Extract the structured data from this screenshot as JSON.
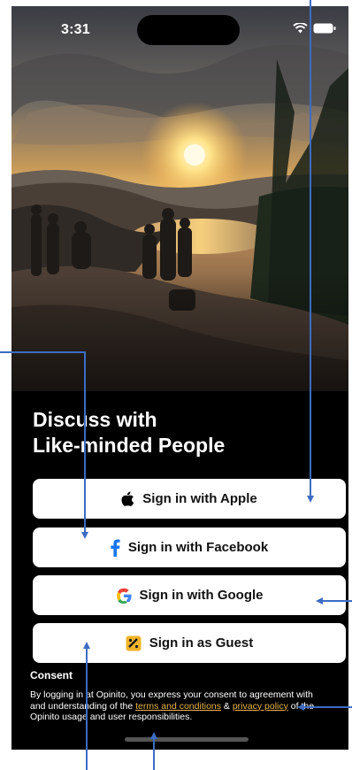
{
  "status_bar": {
    "time": "3:31",
    "icons": [
      "wifi-icon",
      "battery-icon"
    ]
  },
  "hero_image": {
    "description_icon": "sunset-landscape-photo"
  },
  "headline": {
    "line1": "Discuss with",
    "line2": "Like-minded People"
  },
  "buttons": {
    "apple": {
      "label": "Sign in with Apple",
      "icon": "apple-logo-icon"
    },
    "facebook": {
      "label": "Sign in with Facebook",
      "icon": "facebook-logo-icon"
    },
    "google": {
      "label": "Sign in with Google",
      "icon": "google-logo-icon"
    },
    "guest": {
      "label": "Sign in as Guest",
      "icon": "guest-badge-icon"
    }
  },
  "consent": {
    "title": "Consent",
    "text_part1": "By logging in at Opinito, you express your consent to agreement with and understanding of the ",
    "terms_link": "terms and conditions",
    "text_part2": " & ",
    "privacy_link": "privacy policy",
    "text_part3": " of the Opinito usage and user responsibilities."
  },
  "colors": {
    "background": "#000000",
    "button_bg": "#ffffff",
    "link": "#e8b54a",
    "annotation": "#3d6cc4",
    "facebook_blue": "#1877f2",
    "guest_badge": "#f0b429"
  }
}
